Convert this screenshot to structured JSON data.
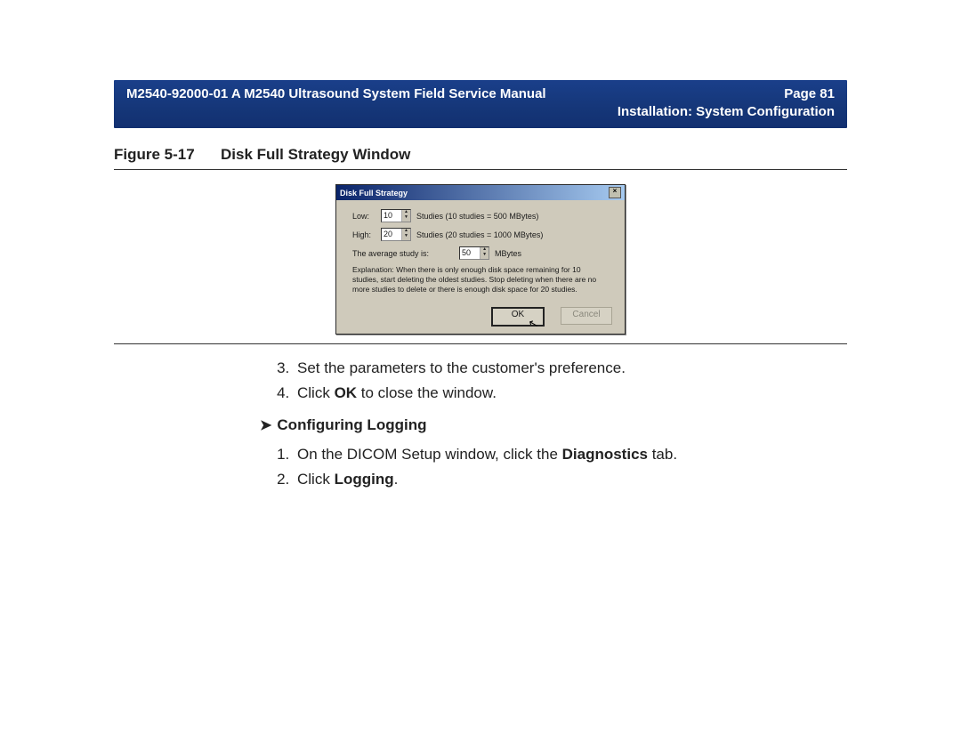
{
  "banner": {
    "left": "M2540-92000-01 A M2540 Ultrasound System Field Service Manual",
    "page_label": "Page 81",
    "section": "Installation: System Configuration"
  },
  "figure": {
    "label": "Figure 5-17",
    "title": "Disk Full Strategy Window"
  },
  "dialog": {
    "title": "Disk Full Strategy",
    "low_label": "Low:",
    "low_value": "10",
    "low_suffix": "Studies (10 studies = 500 MBytes)",
    "high_label": "High:",
    "high_value": "20",
    "high_suffix": "Studies (20 studies = 1000 MBytes)",
    "avg_label": "The average study is:",
    "avg_value": "50",
    "avg_suffix": "MBytes",
    "explanation": "Explanation: When there is only enough disk space remaining for 10 studies, start deleting the oldest studies. Stop deleting when there are no more studies to delete or there is enough disk space for 20 studies.",
    "ok": "OK",
    "cancel": "Cancel"
  },
  "steps_a": {
    "s3": "Set the parameters to the customer's preference.",
    "s4_pre": "Click ",
    "s4_bold": "OK",
    "s4_post": " to close the window."
  },
  "subhead": "Configuring Logging",
  "steps_b": {
    "s1_pre": "On the DICOM Setup window, click the ",
    "s1_bold": "Diagnostics",
    "s1_post": " tab.",
    "s2_pre": "Click ",
    "s2_bold": "Logging",
    "s2_post": "."
  }
}
